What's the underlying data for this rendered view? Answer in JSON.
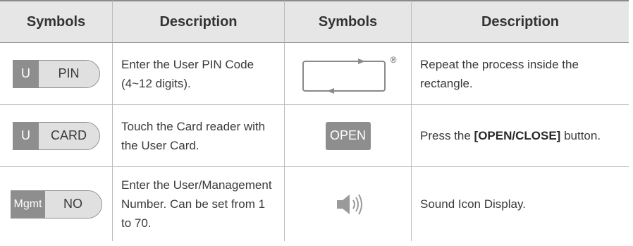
{
  "headers": [
    "Symbols",
    "Description",
    "Symbols",
    "Description"
  ],
  "rows": [
    {
      "left_symbol": {
        "left": "U",
        "right": "PIN"
      },
      "left_desc": "Enter the User PIN Code (4~12 digits).",
      "right_symbol": {
        "mark": "®"
      },
      "right_desc": "Repeat the process inside the rectangle."
    },
    {
      "left_symbol": {
        "left": "U",
        "right": "CARD"
      },
      "left_desc": "Touch the Card reader with the User Card.",
      "right_symbol": {
        "label": "OPEN"
      },
      "right_desc_pre": "Press the ",
      "right_desc_bold": "[OPEN/CLOSE]",
      "right_desc_post": " button."
    },
    {
      "left_symbol": {
        "left": "Mgmt",
        "right": "NO"
      },
      "left_desc": "Enter the User/Management Number. Can be set from 1 to 70.",
      "right_symbol": {
        "icon": "speaker-icon"
      },
      "right_desc": "Sound Icon Display."
    }
  ],
  "colors": {
    "key_dark": "#8e8e8e",
    "key_light": "#e0e0e0",
    "header_bg": "#e6e6e6"
  }
}
